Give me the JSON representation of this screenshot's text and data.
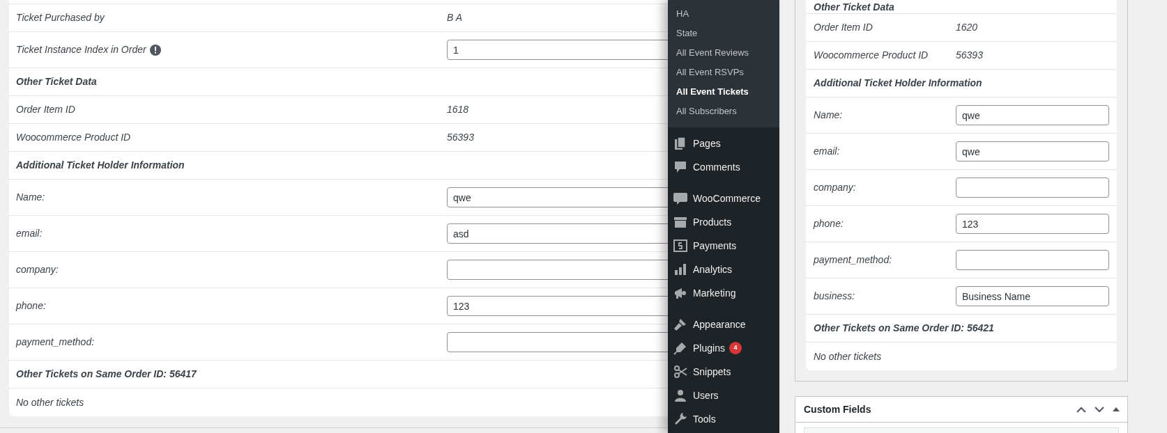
{
  "ticket_details": {
    "rows": [
      {
        "kind": "text",
        "label": "Ticket Purchased by",
        "value": "B A"
      },
      {
        "kind": "input",
        "label": "Ticket Instance Index in Order",
        "info": true,
        "value": "1"
      },
      {
        "kind": "heading",
        "label": "Other Ticket Data"
      },
      {
        "kind": "text",
        "label": "Order Item ID",
        "value": "1618"
      },
      {
        "kind": "text",
        "label": "Woocommerce Product ID",
        "value": "56393"
      },
      {
        "kind": "heading",
        "label": "Additional Ticket Holder Information"
      },
      {
        "kind": "input",
        "label": "Name:",
        "value": "qwe"
      },
      {
        "kind": "input",
        "label": "email:",
        "value": "asd"
      },
      {
        "kind": "input",
        "label": "company:",
        "value": ""
      },
      {
        "kind": "input",
        "label": "phone:",
        "value": "123"
      },
      {
        "kind": "input",
        "label": "payment_method:",
        "value": ""
      },
      {
        "kind": "heading",
        "label": "Other Tickets on Same Order ID: 56417"
      },
      {
        "kind": "text",
        "label": "No other tickets"
      }
    ]
  },
  "sidebar": {
    "submenu": [
      {
        "label": "HA",
        "selected": false
      },
      {
        "label": "State",
        "selected": false
      },
      {
        "label": "All Event Reviews",
        "selected": false
      },
      {
        "label": "All Event RSVPs",
        "selected": false
      },
      {
        "label": "All Event Tickets",
        "selected": true
      },
      {
        "label": "All Subscribers",
        "selected": false
      }
    ],
    "menu_groups": [
      {
        "items": [
          {
            "label": "Pages"
          },
          {
            "label": "Comments"
          }
        ]
      },
      {
        "items": [
          {
            "label": "WooCommerce"
          },
          {
            "label": "Products"
          },
          {
            "label": "Payments"
          },
          {
            "label": "Analytics"
          },
          {
            "label": "Marketing"
          }
        ]
      },
      {
        "items": [
          {
            "label": "Appearance"
          },
          {
            "label": "Plugins",
            "badge": "4"
          },
          {
            "label": "Snippets"
          },
          {
            "label": "Users"
          },
          {
            "label": "Tools"
          }
        ]
      }
    ]
  },
  "side_ticket": {
    "rows": [
      {
        "kind": "heading",
        "label": "Other Ticket Data"
      },
      {
        "kind": "text",
        "label": "Order Item ID",
        "value": "1620"
      },
      {
        "kind": "text",
        "label": "Woocommerce Product ID",
        "value": "56393"
      },
      {
        "kind": "heading",
        "label": "Additional Ticket Holder Information"
      },
      {
        "kind": "input",
        "label": "Name:",
        "value": "qwe"
      },
      {
        "kind": "input",
        "label": "email:",
        "value": "qwe"
      },
      {
        "kind": "input",
        "label": "company:",
        "value": ""
      },
      {
        "kind": "input",
        "label": "phone:",
        "value": "123"
      },
      {
        "kind": "input",
        "label": "payment_method:",
        "value": ""
      },
      {
        "kind": "input",
        "label": "business:",
        "value": "Business Name"
      },
      {
        "kind": "heading",
        "label": "Other Tickets on Same Order ID: 56421"
      },
      {
        "kind": "text",
        "label": "No other tickets"
      }
    ]
  },
  "custom_fields": {
    "title": "Custom Fields"
  }
}
